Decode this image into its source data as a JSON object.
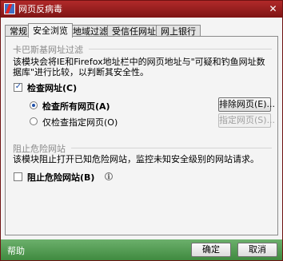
{
  "window": {
    "title": "网页反病毒",
    "close_glyph": "✕"
  },
  "tabs": [
    {
      "label": "常规",
      "active": false
    },
    {
      "label": "安全浏览",
      "active": true
    },
    {
      "label": "地域过滤",
      "active": false
    },
    {
      "label": "受信任网址",
      "active": false
    },
    {
      "label": "网上银行",
      "active": false
    }
  ],
  "section_url_check": {
    "title": "卡巴斯基网址过滤",
    "description": "该模块会将IE和Firefox地址栏中的网页地址与\"可疑和钓鱼网址数据库\"进行比较，以判断其安全性。",
    "check_urls": {
      "label": "检查网址(C)",
      "checked": true
    },
    "check_all": {
      "label": "检查所有网页(A)",
      "selected": true
    },
    "check_specified": {
      "label": "仅检查指定网页(O)",
      "selected": false
    },
    "exclude_button": "排除网页(E)...",
    "specified_button": "指定网页(S)..."
  },
  "section_block_dangerous": {
    "title": "阻止危险网站",
    "description": "该模块阻止打开已知危险网站，监控未知安全级别的网站请求。",
    "block_sites": {
      "label": "阻止危险网站(B)",
      "checked": false
    }
  },
  "footer": {
    "help": "帮助",
    "ok": "确定",
    "cancel": "取消"
  },
  "colors": {
    "titlebar": "#9a1e1e",
    "footer": "#4f9b4f",
    "accent": "#1e4fa8"
  },
  "icons": {
    "app": "kaspersky-k-icon",
    "close": "close-icon",
    "info": "info-icon"
  }
}
